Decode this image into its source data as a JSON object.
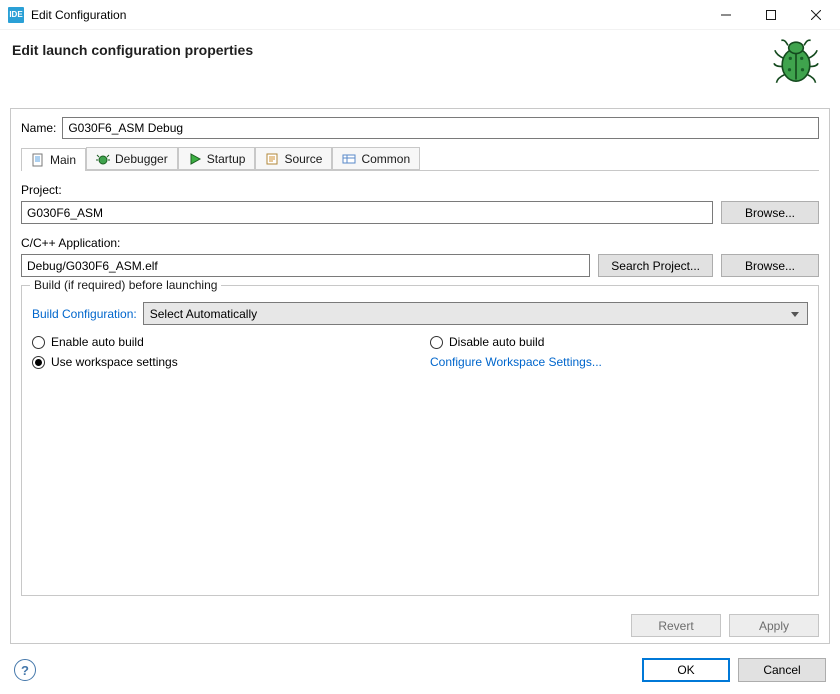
{
  "window": {
    "title": "Edit Configuration",
    "appIconText": "IDE"
  },
  "header": {
    "title": "Edit launch configuration properties"
  },
  "form": {
    "nameLabel": "Name:",
    "nameValue": "G030F6_ASM Debug",
    "tabs": {
      "main": "Main",
      "debugger": "Debugger",
      "startup": "Startup",
      "source": "Source",
      "common": "Common"
    },
    "projectLabel": "Project:",
    "projectValue": "G030F6_ASM",
    "browse": "Browse...",
    "appLabel": "C/C++ Application:",
    "appValue": "Debug/G030F6_ASM.elf",
    "searchProject": "Search Project...",
    "group": {
      "title": "Build (if required) before launching",
      "buildConfigLabel": "Build Configuration:",
      "buildConfigValue": "Select Automatically",
      "enableAuto": "Enable auto build",
      "disableAuto": "Disable auto build",
      "useWorkspace": "Use workspace settings",
      "configureLink": "Configure Workspace Settings..."
    },
    "revert": "Revert",
    "apply": "Apply"
  },
  "footer": {
    "ok": "OK",
    "cancel": "Cancel"
  }
}
